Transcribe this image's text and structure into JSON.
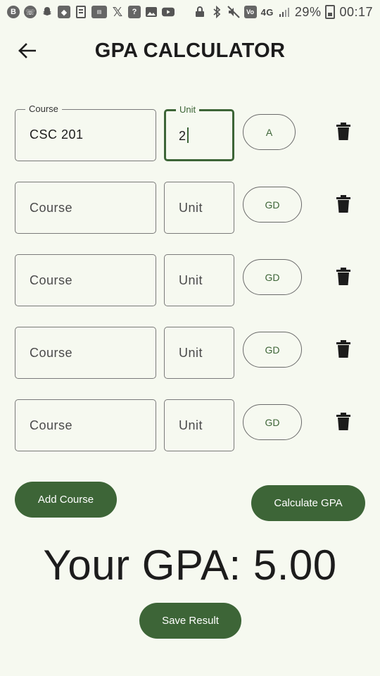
{
  "status_bar": {
    "network": "4G",
    "battery": "29%",
    "time": "00:17"
  },
  "app_bar": {
    "title": "GPA CALCULATOR"
  },
  "course_rows": [
    {
      "course_label": "Course",
      "course_value": "CSC 201",
      "unit_label": "Unit",
      "unit_value": "2",
      "grade": "A"
    },
    {
      "course_placeholder": "Course",
      "unit_placeholder": "Unit",
      "grade": "GD"
    },
    {
      "course_placeholder": "Course",
      "unit_placeholder": "Unit",
      "grade": "GD"
    },
    {
      "course_placeholder": "Course",
      "unit_placeholder": "Unit",
      "grade": "GD"
    },
    {
      "course_placeholder": "Course",
      "unit_placeholder": "Unit",
      "grade": "GD"
    }
  ],
  "actions": {
    "add_course": "Add Course",
    "calculate": "Calculate GPA",
    "save": "Save Result"
  },
  "result": {
    "gpa_text": "Your GPA: 5.00"
  },
  "colors": {
    "primary": "#3d6537",
    "background": "#f6f9f0"
  }
}
